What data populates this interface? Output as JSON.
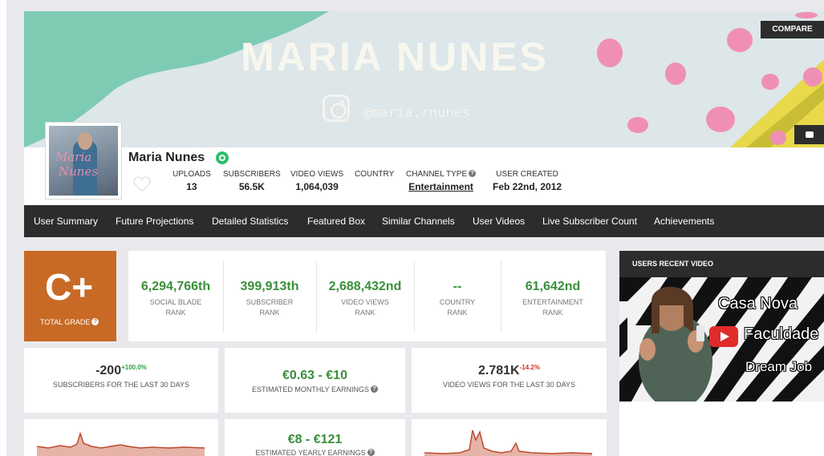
{
  "banner": {
    "title": "MARIA NUNES",
    "handle": "@maria.rnunes",
    "compare_label": "COMPARE",
    "colors": {
      "bg": "#dde6e9",
      "mint": "#7ecbb4",
      "pink": "#f08fb5",
      "gold": "#e7d94a"
    }
  },
  "avatar": {
    "script_line1": "Maria",
    "script_line2": "Nunes"
  },
  "channel": {
    "name": "Maria Nunes",
    "stats": [
      {
        "label": "UPLOADS",
        "value": "13"
      },
      {
        "label": "SUBSCRIBERS",
        "value": "56.5K"
      },
      {
        "label": "VIDEO VIEWS",
        "value": "1,064,039"
      },
      {
        "label": "COUNTRY",
        "value": ""
      },
      {
        "label": "CHANNEL TYPE",
        "value": "Entertainment"
      },
      {
        "label": "USER CREATED",
        "value": "Feb 22nd, 2012"
      }
    ]
  },
  "nav": {
    "items": [
      "User Summary",
      "Future Projections",
      "Detailed Statistics",
      "Featured Box",
      "Similar Channels",
      "User Videos",
      "Live Subscriber Count",
      "Achievements"
    ]
  },
  "grade": {
    "value": "C+",
    "label": "TOTAL GRADE",
    "color": "#c86a25"
  },
  "ranks": [
    {
      "value": "6,294,766th",
      "line1": "SOCIAL BLADE",
      "line2": "RANK"
    },
    {
      "value": "399,913th",
      "line1": "SUBSCRIBER",
      "line2": "RANK"
    },
    {
      "value": "2,688,432nd",
      "line1": "VIDEO VIEWS",
      "line2": "RANK"
    },
    {
      "value": "--",
      "line1": "COUNTRY",
      "line2": "RANK"
    },
    {
      "value": "61,642nd",
      "line1": "ENTERTAINMENT",
      "line2": "RANK"
    }
  ],
  "summary": {
    "subs_30": {
      "value": "-200",
      "delta": "+100.0%",
      "label": "SUBSCRIBERS FOR THE LAST 30 DAYS"
    },
    "monthly": {
      "value": "€0.63  -  €10",
      "label": "ESTIMATED MONTHLY EARNINGS"
    },
    "views_30": {
      "value": "2.781K",
      "delta": "-14.2%",
      "label": "VIDEO VIEWS FOR THE LAST 30 DAYS"
    },
    "yearly": {
      "value": "€8  -  €121",
      "label": "ESTIMATED YEARLY EARNINGS"
    }
  },
  "video": {
    "section_title": "USERS RECENT VIDEO",
    "overlay_line1": "Casa Nova",
    "overlay_line2": "Faculdade",
    "overlay_line3": "Dream Job"
  }
}
